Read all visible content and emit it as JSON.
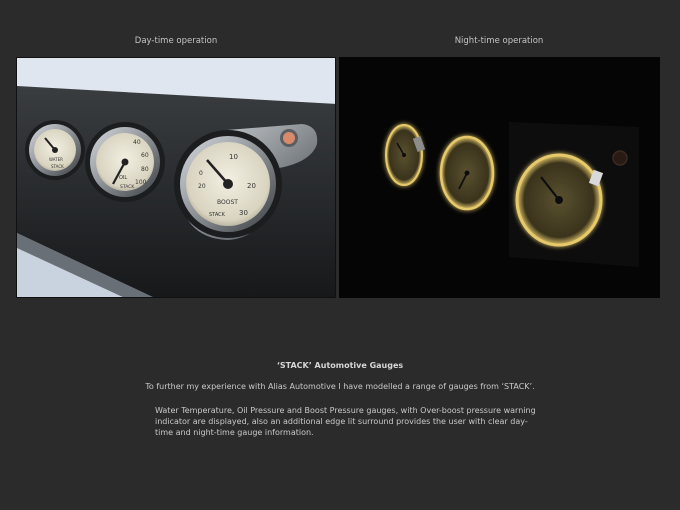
{
  "captions": {
    "day": "Day-time operation",
    "night": "Night-time operation"
  },
  "gauges": {
    "water_temp": {
      "label": "WATER",
      "unit": "°C",
      "brand": "STACK"
    },
    "oil_pressure": {
      "ticks": [
        "20",
        "40",
        "60",
        "80",
        "100"
      ],
      "label": "OIL",
      "brand": "STACK"
    },
    "boost": {
      "ticks": [
        "0",
        "10",
        "20",
        "30",
        "20",
        "10"
      ],
      "label": "BOOST",
      "brand": "STACK"
    }
  },
  "description": {
    "title": "‘STACK’ Automotive Gauges",
    "p1": "To further my experience with Alias Automotive I have modelled a range of gauges from ‘STACK’.",
    "p2": "Water Temperature, Oil Pressure and Boost Pressure gauges, with Over-boost pressure warning indicator are displayed, also an additional edge lit surround provides the user with clear day-time and night-time gauge information."
  },
  "colors": {
    "background": "#2b2b2b",
    "gauge_face": "#e8e4d3",
    "night_glow": "#e6c96a",
    "warning_lamp": "#d98a6a"
  }
}
